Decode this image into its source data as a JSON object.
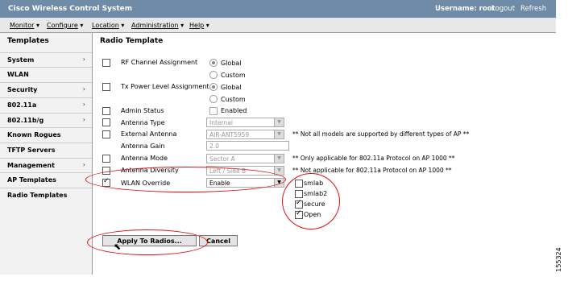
{
  "header": {
    "app_title": "Cisco Wireless Control System",
    "username": "Username: root",
    "logout": "Logout",
    "refresh": "Refresh"
  },
  "menu": [
    "Monitor",
    "Configure",
    "Location",
    "Administration",
    "Help"
  ],
  "sidebar": {
    "heading": "Templates",
    "items": [
      {
        "label": "System",
        "arrow": "›"
      },
      {
        "label": "WLAN",
        "arrow": ""
      },
      {
        "label": "Security",
        "arrow": "›"
      },
      {
        "label": "802.11a",
        "arrow": "›"
      },
      {
        "label": "802.11b/g",
        "arrow": "›"
      },
      {
        "label": "Known Rogues",
        "arrow": ""
      },
      {
        "label": "TFTP Servers",
        "arrow": ""
      },
      {
        "label": "Management",
        "arrow": "›"
      },
      {
        "label": "AP Templates",
        "arrow": ""
      },
      {
        "label": "Radio Templates",
        "arrow": ""
      }
    ]
  },
  "page_title": "Radio Template",
  "form": {
    "rf_channel": {
      "label": "RF Channel Assignment",
      "opt1": "Global",
      "opt2": "Custom"
    },
    "tx_power": {
      "label": "Tx Power Level Assignment",
      "opt1": "Global",
      "opt2": "Custom"
    },
    "admin_status": {
      "label": "Admin Status",
      "value": "Enabled"
    },
    "antenna_type": {
      "label": "Antenna Type",
      "value": "Internal"
    },
    "external_antenna": {
      "label": "External Antenna",
      "value": "AIR-ANT5959",
      "note": "** Not all models are supported by different types of AP **"
    },
    "antenna_gain": {
      "label": "Antenna Gain",
      "value": "2.0"
    },
    "antenna_mode": {
      "label": "Antenna Mode",
      "value": "Sector A",
      "note": "** Only applicable for 802.11a Protocol on AP 1000 **"
    },
    "antenna_diversity": {
      "label": "Antenna Diversity",
      "value": "Left / Side B",
      "note": "** Not applicable for 802.11a Protocol on AP 1000 **"
    },
    "wlan_override": {
      "label": "WLAN Override",
      "value": "Enable"
    },
    "wlans": [
      {
        "label": "smlab",
        "checked": false
      },
      {
        "label": "smlab2",
        "checked": false
      },
      {
        "label": "secure",
        "checked": true
      },
      {
        "label": "Open",
        "checked": true
      }
    ]
  },
  "buttons": {
    "apply": "Apply To Radios...",
    "cancel": "Cancel"
  },
  "figure_id": "155324"
}
